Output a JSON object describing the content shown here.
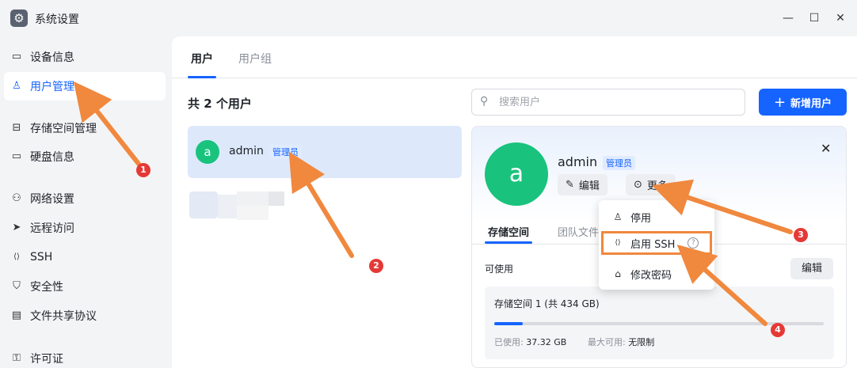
{
  "window": {
    "title": "系统设置",
    "icon": "gear-icon",
    "controls": {
      "minimize": "—",
      "maximize": "☐",
      "close": "✕"
    }
  },
  "sidebar": {
    "items": [
      {
        "label": "设备信息",
        "icon": "drive-icon",
        "glyph": "▭"
      },
      {
        "label": "用户管理",
        "icon": "user-icon",
        "glyph": "♙",
        "active": true
      },
      {
        "label": "存储空间管理",
        "icon": "storage-icon",
        "glyph": "⊟"
      },
      {
        "label": "硬盘信息",
        "icon": "disk-icon",
        "glyph": "▭"
      },
      {
        "label": "网络设置",
        "icon": "network-icon",
        "glyph": "⚇"
      },
      {
        "label": "远程访问",
        "icon": "send-icon",
        "glyph": "➤"
      },
      {
        "label": "SSH",
        "icon": "code-icon",
        "glyph": "⟨⟩"
      },
      {
        "label": "安全性",
        "icon": "shield-icon",
        "glyph": "⛉"
      },
      {
        "label": "文件共享协议",
        "icon": "file-icon",
        "glyph": "▤"
      },
      {
        "label": "许可证",
        "icon": "key-icon",
        "glyph": "⚿"
      }
    ]
  },
  "main": {
    "tabs": [
      {
        "label": "用户",
        "active": true
      },
      {
        "label": "用户组",
        "active": false
      }
    ],
    "count_label": "共 2 个用户",
    "search": {
      "placeholder": "搜索用户",
      "icon": "search-icon"
    },
    "add_button": "新增用户",
    "user_list": [
      {
        "avatar": "a",
        "name": "admin",
        "role": "管理员",
        "selected": true
      }
    ]
  },
  "detail": {
    "avatar": "a",
    "name": "admin",
    "role": "管理员",
    "edit_button": "编辑",
    "more_button": "更多",
    "tabs": [
      {
        "label": "存储空间",
        "active": true
      },
      {
        "label": "团队文件",
        "active": false
      }
    ],
    "available_label": "可使用",
    "edit2_button": "编辑",
    "storage": {
      "name": "存储空间 1 (共 434 GB)",
      "used_label": "已使用:",
      "used_value": "37.32 GB",
      "max_label": "最大可用:",
      "max_value": "无限制",
      "used_fraction": 0.086
    }
  },
  "menu": {
    "items": [
      {
        "label": "停用",
        "icon": "user-disable-icon",
        "glyph": "♙"
      },
      {
        "label": "启用 SSH",
        "icon": "code-icon",
        "glyph": "⟨⟩",
        "highlighted": true
      },
      {
        "label": "修改密码",
        "icon": "lock-icon",
        "glyph": "🔒︎"
      }
    ]
  },
  "annotations": {
    "color": "#f0883e",
    "markers": [
      "1",
      "2",
      "3",
      "4"
    ]
  }
}
